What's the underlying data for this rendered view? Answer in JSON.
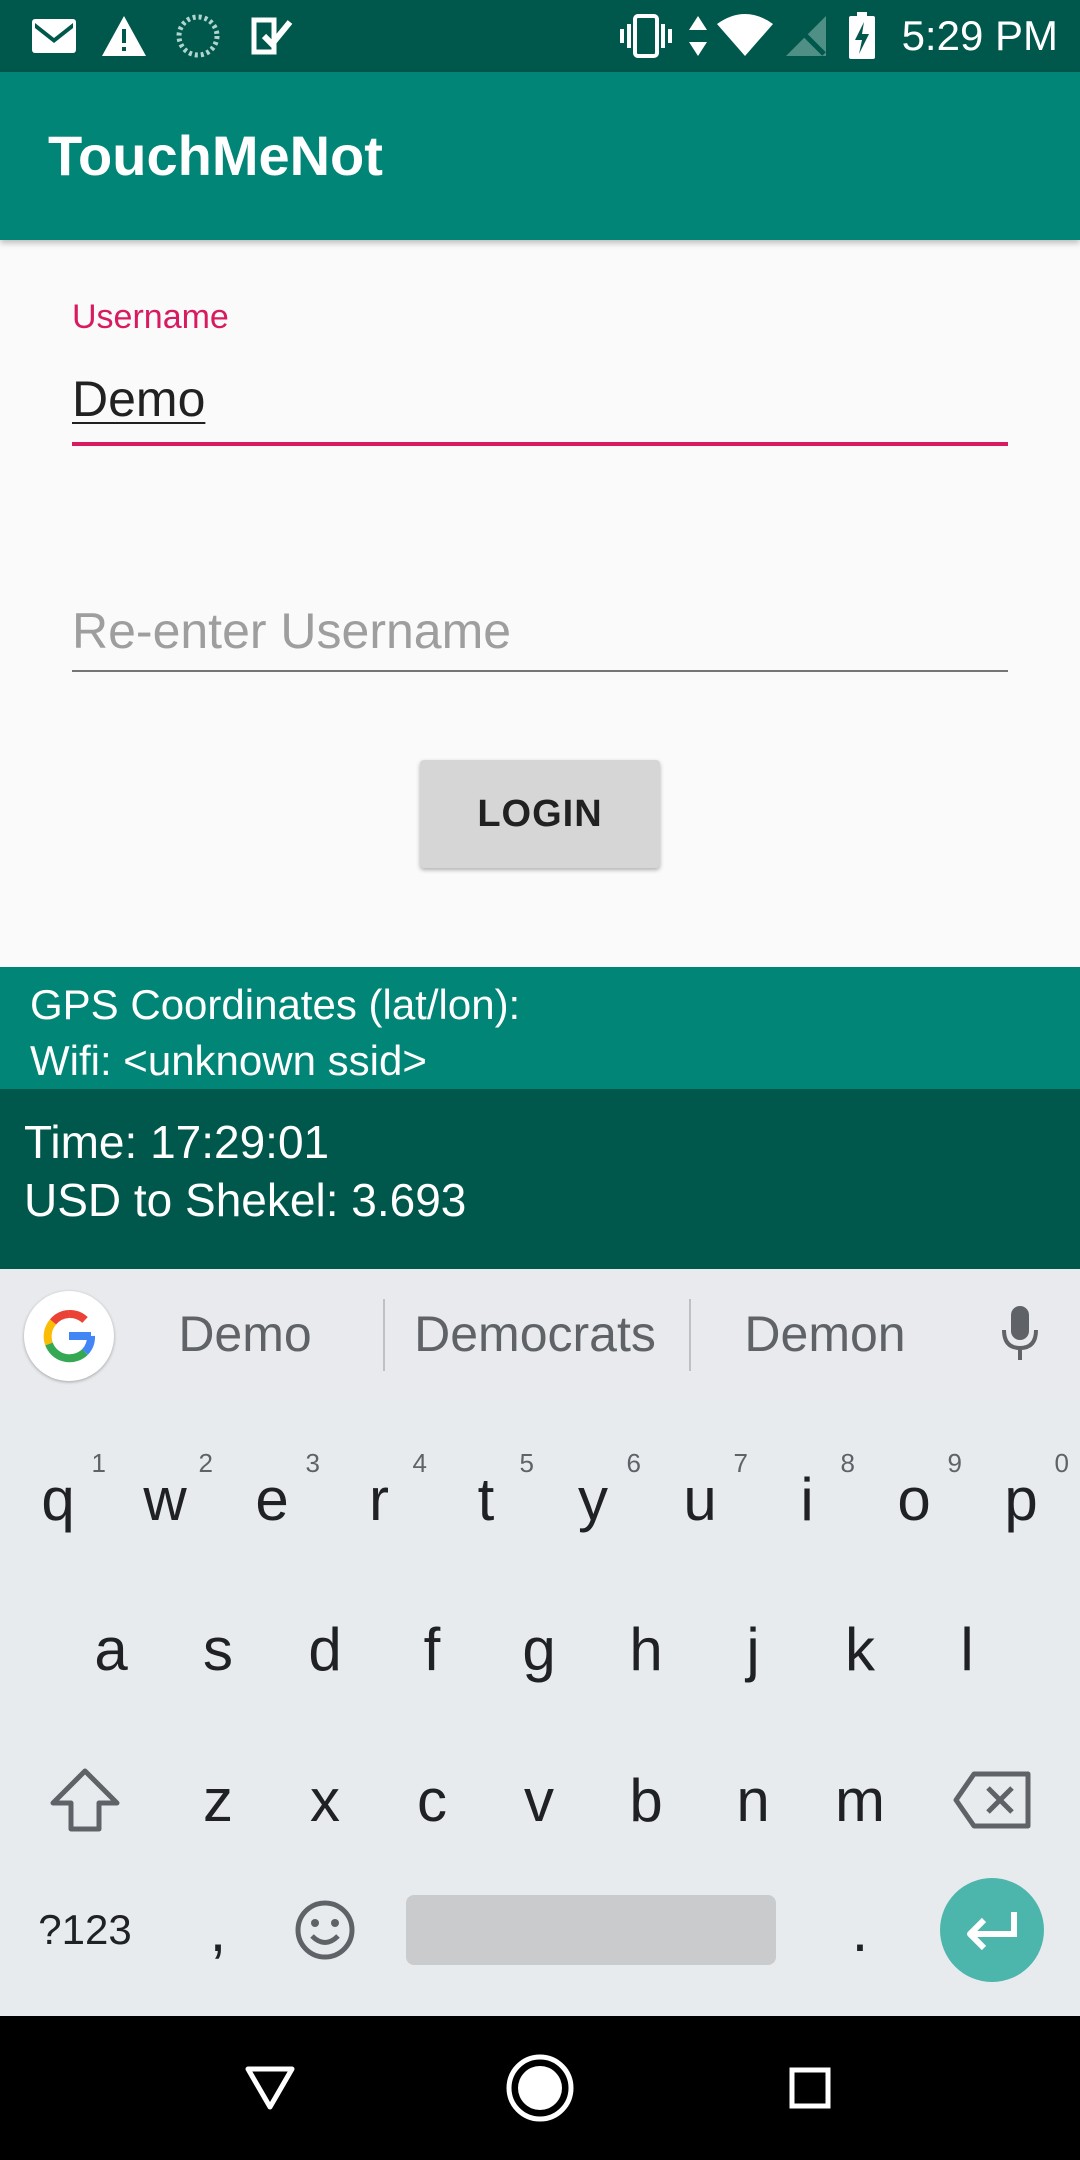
{
  "status_bar": {
    "time": "5:29 PM",
    "icons": [
      "gmail-icon",
      "warning-icon",
      "loading-icon",
      "task-check-icon",
      "vibrate-icon",
      "data-arrows-icon",
      "wifi-icon",
      "no-signal-icon",
      "battery-charging-icon"
    ]
  },
  "app_bar": {
    "title": "TouchMeNot",
    "color": "#008577"
  },
  "form": {
    "username_label": "Username",
    "username_value": "Demo",
    "reenter_placeholder": "Re-enter Username",
    "login_label": "LOGIN",
    "accent_color": "#d81b60"
  },
  "info": {
    "gps": "GPS Coordinates (lat/lon):",
    "wifi": "Wifi: <unknown ssid>",
    "time": "Time: 17:29:01",
    "usd": "USD to Shekel: 3.693"
  },
  "keyboard": {
    "suggestions": [
      "Demo",
      "Democrats",
      "Demon"
    ],
    "row1": [
      {
        "k": "q",
        "h": "1"
      },
      {
        "k": "w",
        "h": "2"
      },
      {
        "k": "e",
        "h": "3"
      },
      {
        "k": "r",
        "h": "4"
      },
      {
        "k": "t",
        "h": "5"
      },
      {
        "k": "y",
        "h": "6"
      },
      {
        "k": "u",
        "h": "7"
      },
      {
        "k": "i",
        "h": "8"
      },
      {
        "k": "o",
        "h": "9"
      },
      {
        "k": "p",
        "h": "0"
      }
    ],
    "row2": [
      "a",
      "s",
      "d",
      "f",
      "g",
      "h",
      "j",
      "k",
      "l"
    ],
    "row3": [
      "z",
      "x",
      "c",
      "v",
      "b",
      "n",
      "m"
    ],
    "symbols_label": "?123",
    "comma": ",",
    "period": "."
  },
  "nav_bar": {
    "buttons": [
      "back-icon",
      "home-icon",
      "recents-icon"
    ]
  }
}
